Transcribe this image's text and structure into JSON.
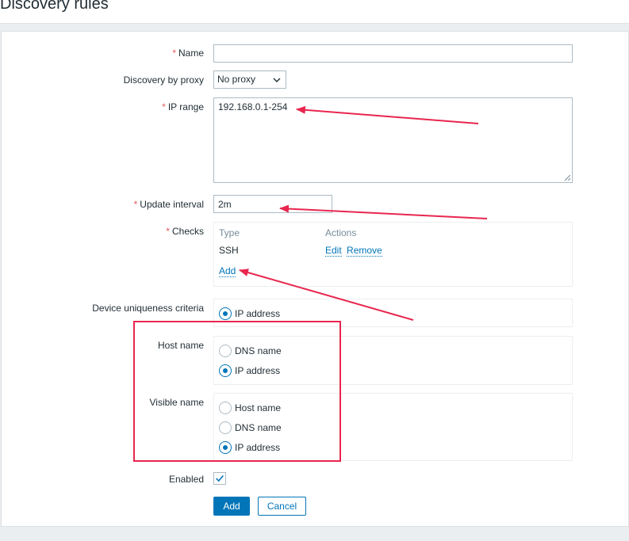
{
  "page": {
    "title": "Discovery rules"
  },
  "form": {
    "name": {
      "label": "Name",
      "required_mark": "*",
      "value": ""
    },
    "proxy": {
      "label": "Discovery by proxy",
      "selected": "No proxy"
    },
    "ip_range": {
      "label": "IP range",
      "required_mark": "*",
      "value": "192.168.0.1-254"
    },
    "update_interval": {
      "label": "Update interval",
      "required_mark": "*",
      "value": "2m"
    },
    "checks": {
      "label": "Checks",
      "required_mark": "*",
      "columns": [
        "Type",
        "Actions"
      ],
      "rows": [
        {
          "type": "SSH",
          "edit": "Edit",
          "remove": "Remove"
        }
      ],
      "add_link": "Add"
    },
    "uniqueness": {
      "label": "Device uniqueness criteria",
      "options": [
        "IP address"
      ],
      "selected": "IP address"
    },
    "host_name": {
      "label": "Host name",
      "options": [
        "DNS name",
        "IP address"
      ],
      "selected": "IP address"
    },
    "visible_name": {
      "label": "Visible name",
      "options": [
        "Host name",
        "DNS name",
        "IP address"
      ],
      "selected": "IP address"
    },
    "enabled": {
      "label": "Enabled",
      "checked": true
    },
    "buttons": {
      "add": "Add",
      "cancel": "Cancel"
    }
  },
  "colors": {
    "accent": "#0275b8",
    "required": "#e45959",
    "annotation": "#e8264f"
  }
}
